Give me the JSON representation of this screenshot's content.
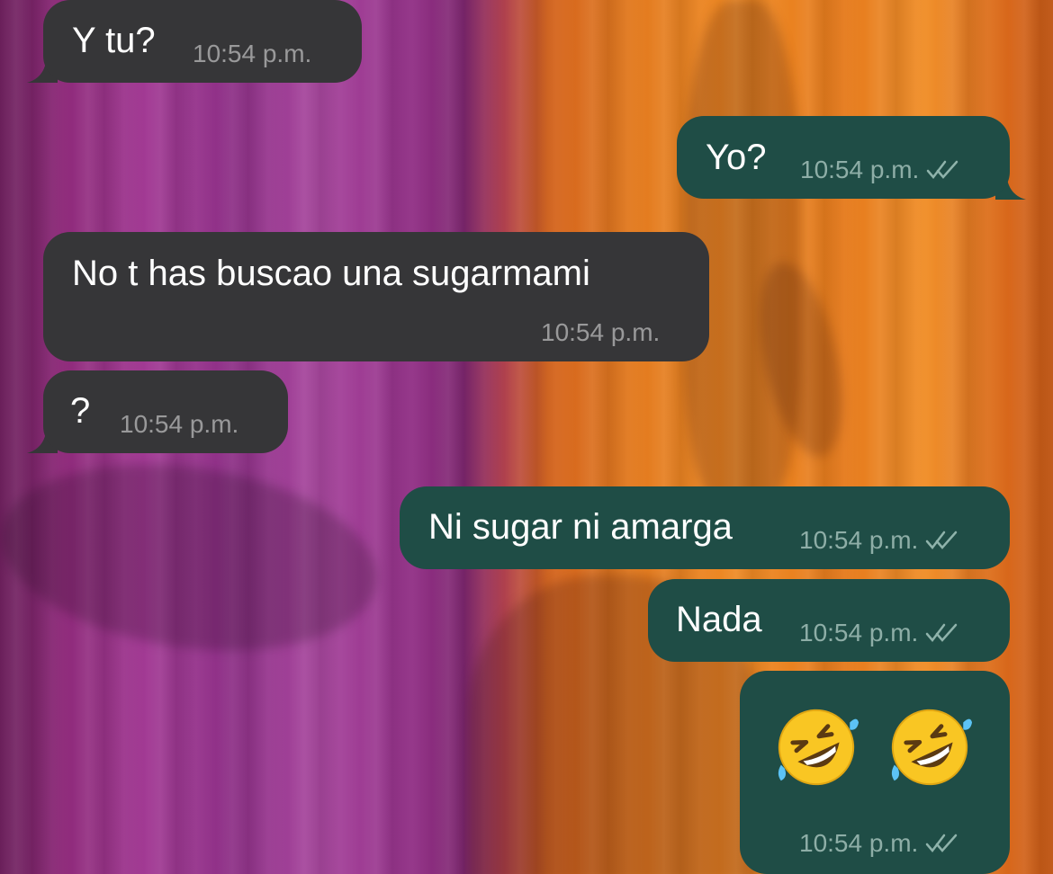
{
  "messages": [
    {
      "direction": "incoming",
      "text": "Y tu?",
      "time": "10:54 p.m."
    },
    {
      "direction": "outgoing",
      "text": "Yo?",
      "time": "10:54 p.m.",
      "status": "double-check-read-icon"
    },
    {
      "direction": "incoming",
      "text": "No t has buscao una sugarmami",
      "time": "10:54 p.m."
    },
    {
      "direction": "incoming",
      "text": "?",
      "time": "10:54 p.m."
    },
    {
      "direction": "outgoing",
      "text": "Ni sugar ni amarga",
      "time": "10:54 p.m.",
      "status": "double-check-read-icon"
    },
    {
      "direction": "outgoing",
      "text": "Nada",
      "time": "10:54 p.m.",
      "status": "double-check-read-icon"
    },
    {
      "direction": "outgoing",
      "text": "🤣🤣",
      "emoji": [
        "rolling-on-floor-laughing-emoji",
        "rolling-on-floor-laughing-emoji"
      ],
      "time": "10:54 p.m.",
      "status": "double-check-read-icon"
    }
  ],
  "colors": {
    "incoming_bubble": "#363638",
    "outgoing_bubble": "#1f4d46",
    "text": "#ffffff",
    "timestamp": "#a8a8aa"
  }
}
